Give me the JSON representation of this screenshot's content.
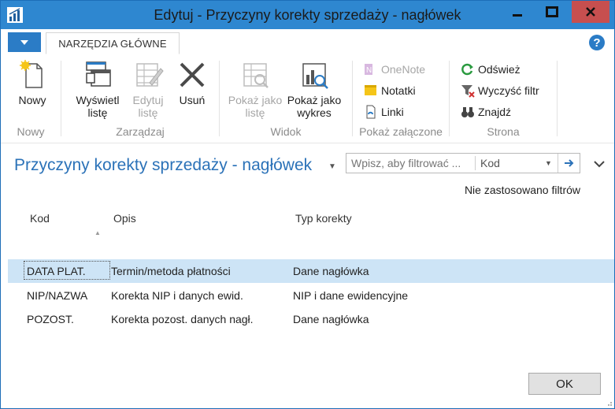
{
  "window": {
    "title": "Edytuj - Przyczyny korekty sprzedaży - nagłówek",
    "controls": {
      "minimize_icon": "minimize-icon",
      "maximize_icon": "maximize-icon",
      "close_icon": "close-icon"
    }
  },
  "ribbon": {
    "file_tab_icon": "caret-down-icon",
    "home_tab": "NARZĘDZIA GŁÓWNE",
    "groups": {
      "nowy": {
        "label": "Nowy",
        "new": "Nowy"
      },
      "zarzadzaj": {
        "label": "Zarządzaj",
        "view_list": "Wyświetl listę",
        "edit_list": "Edytuj listę",
        "delete": "Usuń"
      },
      "widok": {
        "label": "Widok",
        "show_list": "Pokaż jako listę",
        "show_chart": "Pokaż jako wykres"
      },
      "pokaz_zalaczone": {
        "label": "Pokaż załączone",
        "onenote": "OneNote",
        "notes": "Notatki",
        "links": "Linki"
      },
      "strona": {
        "label": "Strona",
        "refresh": "Odśwież",
        "clear_filter": "Wyczyść filtr",
        "find": "Znajdź"
      }
    }
  },
  "page": {
    "title": "Przyczyny korekty sprzedaży - nagłówek",
    "search_placeholder": "Wpisz, aby filtrować ...",
    "filter_field": "Kod",
    "filter_status": "Nie zastosowano filtrów"
  },
  "table": {
    "columns": [
      "Kod",
      "Opis",
      "Typ korekty"
    ],
    "rows": [
      {
        "code": "DATA PLAT.",
        "description": "Termin/metoda płatności",
        "type": "Dane nagłówka",
        "selected": true
      },
      {
        "code": "NIP/NAZWA",
        "description": "Korekta NIP i danych ewid.",
        "type": "NIP i dane ewidencyjne",
        "selected": false
      },
      {
        "code": "POZOST.",
        "description": "Korekta pozost. danych nagł.",
        "type": "Dane nagłówka",
        "selected": false
      }
    ]
  },
  "footer": {
    "ok": "OK"
  },
  "colors": {
    "titlebar": "#2e87d0",
    "accent": "#2b72b8",
    "selected_row": "#cde4f6",
    "close_button": "#c74f4f"
  }
}
